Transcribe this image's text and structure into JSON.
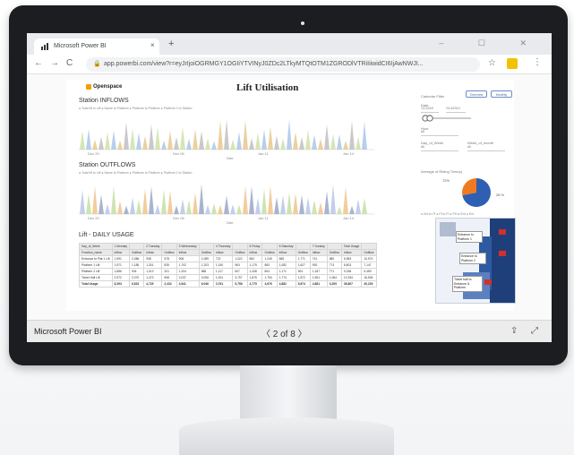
{
  "browser": {
    "tab_title": "Microsoft Power BI",
    "tab_close": "×",
    "new_tab": "+",
    "url": "app.powerbi.com/view?r=eyJrIjoiOGRMGY1OGIiYTVINyJ0ZDc2LTkyMTQtOTM1ZGRODlVTRiIiiwidCI6IjAwNWJI...",
    "back": "←",
    "forward": "→",
    "refresh": "C",
    "star": "☆",
    "kebab": "⋮",
    "window_controls": "– ☐ ✕"
  },
  "report": {
    "brand": "Openspace",
    "title": "Lift Utilisation",
    "inflows_label": "Station INFLOWS",
    "outflows_label": "Station OUTFLOWS",
    "daily_label": "Lift - DAILY USAGE",
    "inflow_legend": "● Total lift to Lift  ● Name to Platform  ● Platform to Platform  ● Platform 2 to Station",
    "outflow_legend": "● Total lift to Lift  ● Name to Platform  ● Platform to Platform  ● Platform 2 to Station",
    "pie_title": "Average of Riding Time(s)",
    "pie_left_label": "72%",
    "pie_right_label": "28 %",
    "pie_legend": "● Ent to Pl  ● Pl to Pl  ● Plt to Ent  ● Ent",
    "x_ticks_in": [
      "Dec 20",
      "Dec 06",
      "Jan 11",
      "Jan 14"
    ],
    "x_ticks_out": [
      "Dec 20",
      "Dec 06",
      "Jan 11",
      "Jan 14"
    ],
    "axis_label": "Date",
    "slicer": {
      "buttons": [
        "Overview",
        "Monthly"
      ],
      "calendar": "Calendar Filter",
      "date": "Date",
      "date_from": "1/1/2018",
      "date_to": "2/14/2019",
      "hour": "Hour",
      "day_of_week": "Day_of_Week",
      "week_of_month": "Week_of_month",
      "all": "All"
    },
    "table": {
      "header_row1": [
        "Day_of_Week",
        "1 Monday",
        "",
        "2 Tuesday",
        "",
        "3 Wednesday",
        "",
        "4 Thursday",
        "",
        "5 Friday",
        "",
        "6 Saturday",
        "",
        "7 Sunday",
        "",
        "Total Usage",
        ""
      ],
      "header_row2": [
        "Function_name",
        "Inflow",
        "Outflow",
        "Inflow",
        "Outflow",
        "Inflow",
        "Outflow",
        "Inflow",
        "Outflow",
        "Inflow",
        "Outflow",
        "Inflow",
        "Outflow",
        "Inflow",
        "Outflow",
        "Inflow",
        "Outflow"
      ],
      "rows": [
        [
          "Entrance to Plat 1 Lift",
          "1,591",
          "2,086",
          "938",
          "578",
          "908",
          "1,089",
          "722",
          "1,022",
          "852",
          "1,245",
          "865",
          "1,771",
          "741",
          "680",
          "6,983",
          "10,974"
        ],
        [
          "Platform 1 Lift",
          "1,971",
          "1,185",
          "1,301",
          "835",
          "1,702",
          "1,203",
          "1,150",
          "963",
          "1,175",
          "883",
          "1,082",
          "1,627",
          "992",
          "774",
          "8,803",
          "7,147"
        ],
        [
          "Platform 2 Lift",
          "1,886",
          "934",
          "1,013",
          "321",
          "1,204",
          "588",
          "1,117",
          "607",
          "1,438",
          "804",
          "1,171",
          "904",
          "1,187",
          "771",
          "9,158",
          "5,459"
        ],
        [
          "Ticket Hall Lift",
          "2,972",
          "2,070",
          "1,473",
          "698",
          "2,037",
          "3,006",
          "1,001",
          "3,707",
          "1,876",
          "1,754",
          "1,774",
          "1,572",
          "1,961",
          "1,084",
          "12,254",
          "16,594"
        ]
      ],
      "total": [
        "Total Usage",
        "8,393",
        "6,815",
        "4,725",
        "2,432",
        "4,541",
        "6,046",
        "3,761",
        "5,758",
        "4,775",
        "4,676",
        "4,882",
        "5,874",
        "4,881",
        "3,209",
        "36,807",
        "40,230"
      ]
    },
    "lift_tags": [
      "Entrance to Platform 1",
      "Entrance to Platform 2",
      "Ticket hall to Entrance & Platform"
    ],
    "chart_series": {
      "inflow_colors": [
        "#cfe0a8",
        "#a9c7e8",
        "#e7c98e",
        "#bfbfbf"
      ],
      "outflow_colors": [
        "#b7c6e6",
        "#c5dfa3",
        "#f0c48a",
        "#9aa7c7"
      ],
      "pie_values": [
        72,
        28
      ],
      "pie_colors": [
        "#2f5fb3",
        "#f07a1f"
      ]
    }
  },
  "footer": {
    "brand": "Microsoft Power BI",
    "pager": "〈   2 of 8   〉",
    "share_icon": "share-icon",
    "expand_icon": "expand-icon"
  }
}
